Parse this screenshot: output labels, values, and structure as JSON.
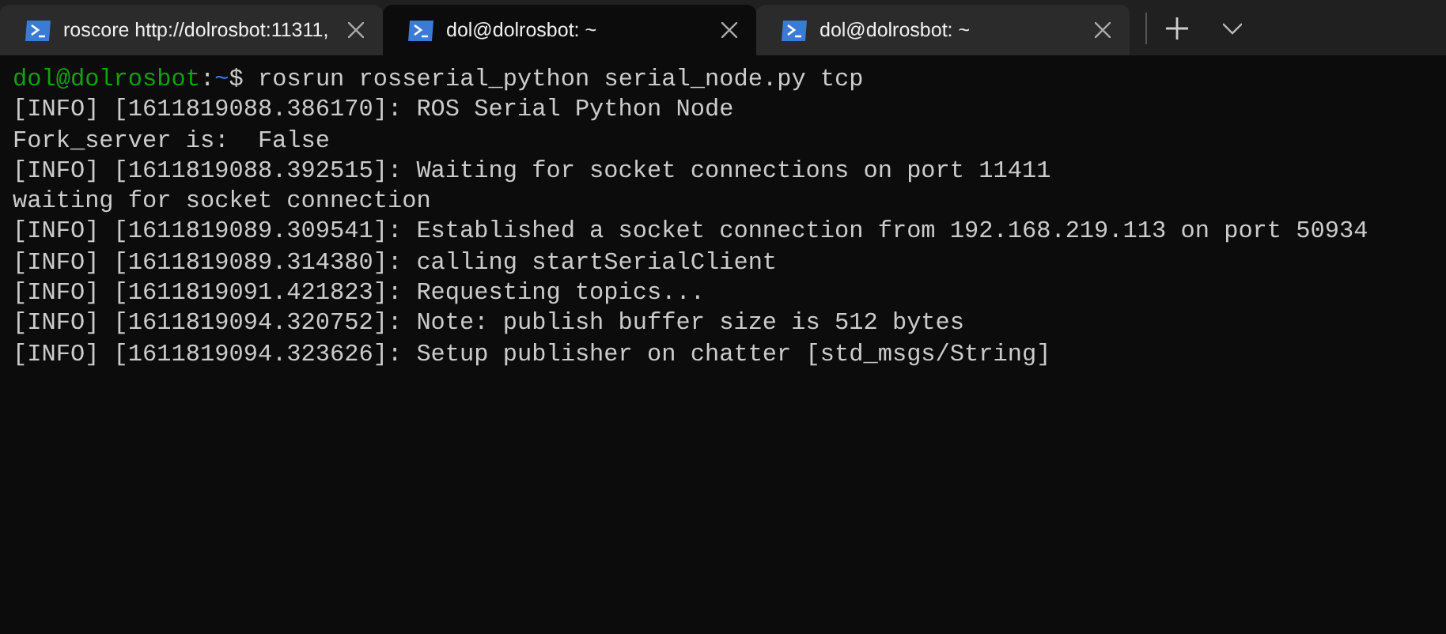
{
  "tabs": [
    {
      "title": "roscore http://dolrosbot:11311,",
      "selected": false
    },
    {
      "title": "dol@dolrosbot: ~",
      "selected": true
    },
    {
      "title": "dol@dolrosbot: ~",
      "selected": false
    }
  ],
  "prompt": {
    "user": "dol@dolrosbot",
    "separator": ":",
    "path": "~",
    "symbol": "$",
    "command": "rosrun rosserial_python serial_node.py tcp"
  },
  "output": [
    "[INFO] [1611819088.386170]: ROS Serial Python Node",
    "Fork_server is:  False",
    "[INFO] [1611819088.392515]: Waiting for socket connections on port 11411",
    "waiting for socket connection",
    "[INFO] [1611819089.309541]: Established a socket connection from 192.168.219.113 on port 50934",
    "[INFO] [1611819089.314380]: calling startSerialClient",
    "[INFO] [1611819091.421823]: Requesting topics...",
    "[INFO] [1611819094.320752]: Note: publish buffer size is 512 bytes",
    "[INFO] [1611819094.323626]: Setup publisher on chatter [std_msgs/String]"
  ]
}
